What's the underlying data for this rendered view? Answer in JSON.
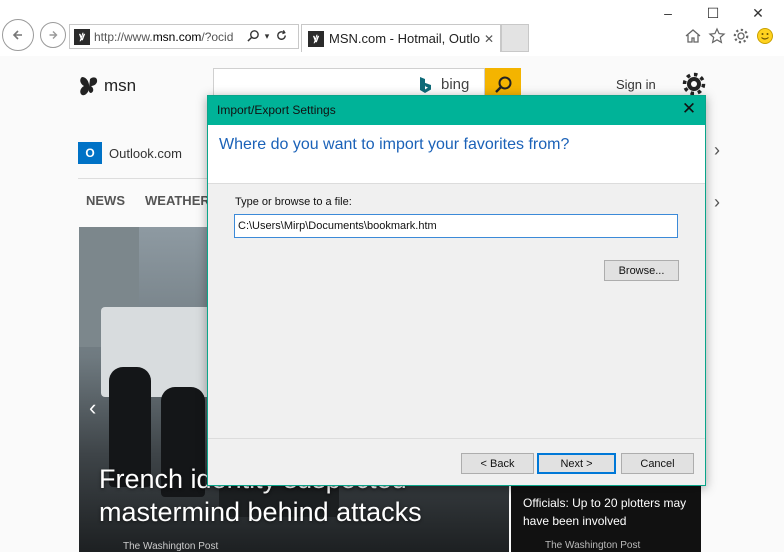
{
  "browser": {
    "url_prefix": "http://www.",
    "url_domain": "msn.com",
    "url_rest": "/?ocid",
    "tab_title": "MSN.com - Hotmail, Outlo...",
    "window_controls": {
      "minimize": "–",
      "maximize": "☐",
      "close": "✕"
    },
    "icons": [
      "back-icon",
      "forward-icon",
      "search-icon",
      "refresh-icon",
      "tab-close-icon",
      "home-icon",
      "favorites-star-icon",
      "tools-gear-icon",
      "feedback-smiley-icon"
    ]
  },
  "page": {
    "logo_text": "msn",
    "search_brand": "bing",
    "signin": "Sign in",
    "outlook_label": "Outlook.com",
    "nav": [
      "NEWS",
      "WEATHER"
    ],
    "hero_caption": "French identity suspected mastermind behind attacks",
    "hero_source": "The Washington Post",
    "side_headline": "Officials: Up to 20 plotters may have been involved",
    "side_source": "The Washington Post"
  },
  "dialog": {
    "title": "Import/Export Settings",
    "heading": "Where do you want to import your favorites from?",
    "file_label": "Type or browse to a file:",
    "file_value": "C:\\Users\\Mirp\\Documents\\bookmark.htm",
    "browse_label": "Browse...",
    "back_label": "< Back",
    "next_label": "Next >",
    "cancel_label": "Cancel",
    "close_glyph": "✕"
  },
  "colors": {
    "dialog_titlebar": "#00b398",
    "heading_blue": "#1b62b8",
    "bing_yellow": "#f4b400",
    "outlook_blue": "#0072c6"
  }
}
